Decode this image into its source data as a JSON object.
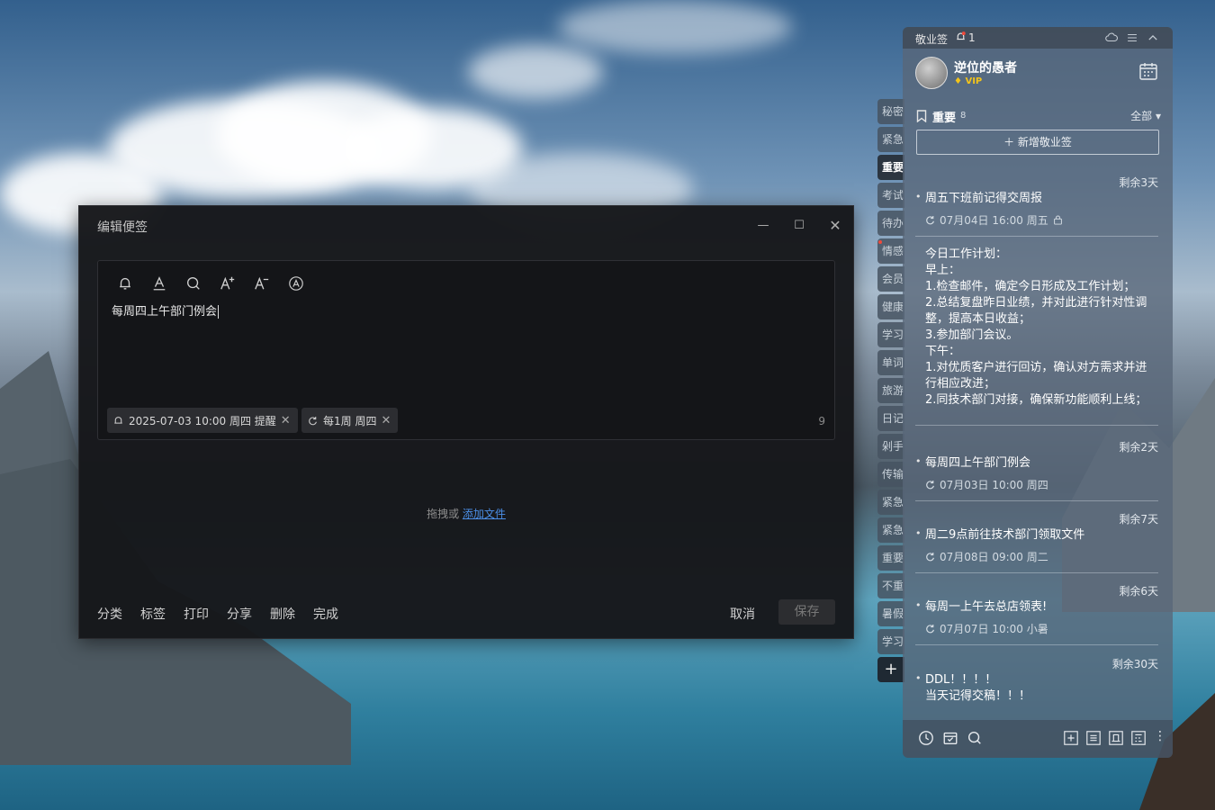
{
  "editor_window": {
    "title": "编辑便签",
    "content": "每周四上午部门例会",
    "reminder_chip": "2025-07-03 10:00 周四 提醒",
    "repeat_chip": "每1周 周四",
    "char_count": "9",
    "drop_text": "拖拽或",
    "add_file_link": "添加文件",
    "actions": [
      "分类",
      "标签",
      "打印",
      "分享",
      "删除",
      "完成"
    ],
    "cancel_label": "取消",
    "save_label": "保存",
    "toolbar_icons": [
      "bell-icon",
      "font-color-icon",
      "search-icon",
      "font-increase-icon",
      "font-decrease-icon",
      "text-style-icon"
    ]
  },
  "side_tabs": {
    "items": [
      "秘密",
      "紧急",
      "重要",
      "考试",
      "待办",
      "情感",
      "会员",
      "健康",
      "学习",
      "单词",
      "旅游",
      "日记",
      "剁手",
      "传输",
      "紧急",
      "紧急",
      "重要",
      "不重",
      "暑假",
      "学习"
    ],
    "active_index": 2,
    "add_label": "+"
  },
  "panel": {
    "app_name": "敬业签",
    "notification_count": "1",
    "username": "逆位的愚者",
    "vip_label": "VIP",
    "category": "重要",
    "category_count": "8",
    "filter": "全部",
    "new_button": "新增敬业签",
    "notes": [
      {
        "remaining": "剩余3天",
        "title": "周五下班前记得交周报",
        "date": "07月04日 16:00 周五"
      },
      {
        "remaining": "",
        "title": "今日工作计划：\n早上：\n1.检查邮件，确定今日形成及工作计划；\n2.总结复盘昨日业绩，并对此进行针对性调整，提高本日收益；\n3.参加部门会议。\n下午：\n1.对优质客户进行回访，确认对方需求并进行相应改进；\n2.同技术部门对接，确保新功能顺利上线；",
        "date": ""
      },
      {
        "remaining": "剩余2天",
        "title": "每周四上午部门例会",
        "date": "07月03日 10:00 周四"
      },
      {
        "remaining": "剩余7天",
        "title": "周二9点前往技术部门领取文件",
        "date": "07月08日 09:00 周二"
      },
      {
        "remaining": "剩余6天",
        "title": "每周一上午去总店领表!",
        "date": "07月07日 10:00 小暑"
      },
      {
        "remaining": "剩余30天",
        "title": "DDL！！！！\n当天记得交稿！！！",
        "date": ""
      }
    ]
  },
  "colors": {
    "accent_link": "#4b8ee6",
    "vip_gold": "#f2c31b",
    "notification_red": "#ef4a3b"
  }
}
